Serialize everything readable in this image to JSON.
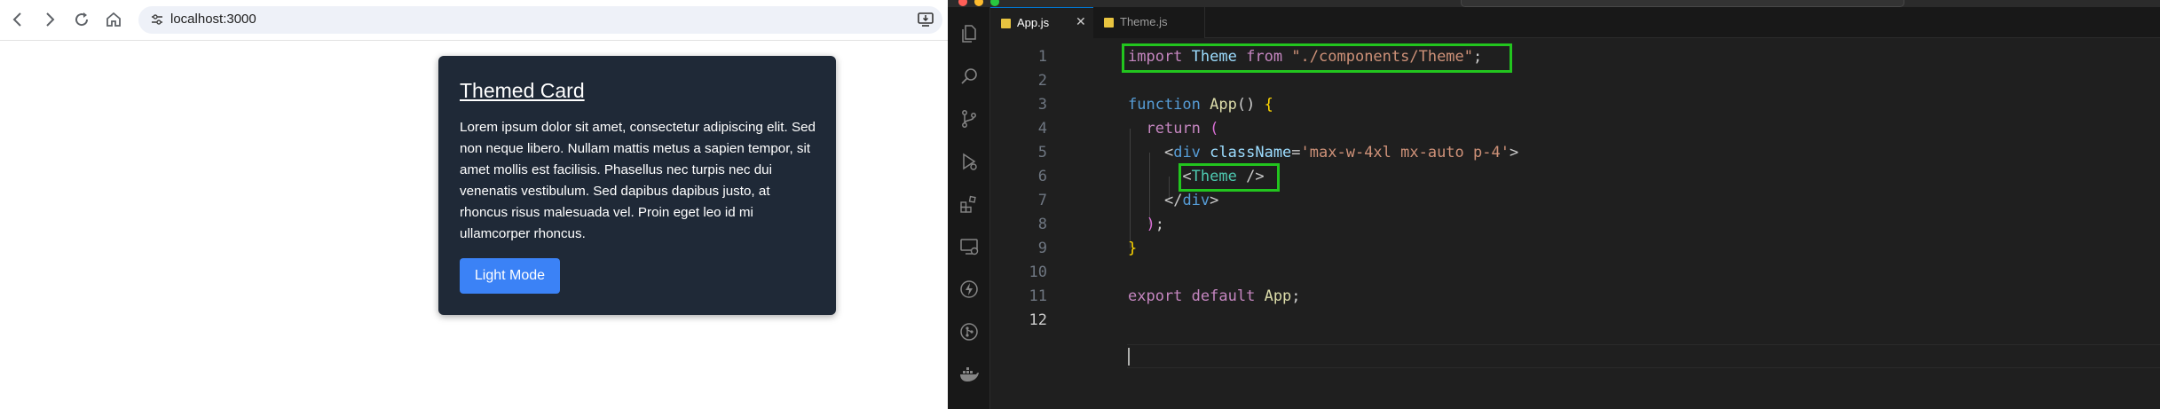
{
  "browser": {
    "url": "localhost:3000",
    "card": {
      "title": "Themed Card",
      "body": "Lorem ipsum dolor sit amet, consectetur adipiscing elit. Sed non neque libero. Nullam mattis metus a sapien tempor, sit amet mollis est facilisis. Phasellus nec turpis nec dui venenatis vestibulum. Sed dapibus dapibus justo, at rhoncus risus malesuada vel. Proin eget leo id mi ullamcorper rhoncus.",
      "button_label": "Light Mode"
    },
    "icons": [
      "back-icon",
      "forward-icon",
      "reload-icon",
      "home-icon",
      "site-info-icon",
      "install-app-icon"
    ]
  },
  "editor": {
    "tabs": [
      {
        "label": "App.js",
        "active": true
      },
      {
        "label": "Theme.js",
        "active": false
      }
    ],
    "active_line": 12,
    "lines": [
      {
        "num": "1",
        "tokens": [
          {
            "t": "import",
            "c": "kw"
          },
          {
            "t": " "
          },
          {
            "t": "Theme",
            "c": "var"
          },
          {
            "t": " "
          },
          {
            "t": "from",
            "c": "kw"
          },
          {
            "t": " "
          },
          {
            "t": "\"./components/Theme\"",
            "c": "str"
          },
          {
            "t": ";",
            "c": "punc"
          }
        ]
      },
      {
        "num": "2",
        "tokens": []
      },
      {
        "num": "3",
        "tokens": [
          {
            "t": "function",
            "c": "kw2"
          },
          {
            "t": " "
          },
          {
            "t": "App",
            "c": "fn"
          },
          {
            "t": "() ",
            "c": "punc"
          },
          {
            "t": "{",
            "c": "brace"
          }
        ]
      },
      {
        "num": "4",
        "tokens": [
          {
            "t": "  "
          },
          {
            "t": "return",
            "c": "kw"
          },
          {
            "t": " "
          },
          {
            "t": "(",
            "c": "brace2"
          }
        ]
      },
      {
        "num": "5",
        "tokens": [
          {
            "t": "    "
          },
          {
            "t": "<",
            "c": "punc"
          },
          {
            "t": "div",
            "c": "tag"
          },
          {
            "t": " "
          },
          {
            "t": "className",
            "c": "var"
          },
          {
            "t": "=",
            "c": "punc"
          },
          {
            "t": "'max-w-4xl mx-auto p-4'",
            "c": "str"
          },
          {
            "t": ">",
            "c": "punc"
          }
        ]
      },
      {
        "num": "6",
        "tokens": [
          {
            "t": "      "
          },
          {
            "t": "<",
            "c": "punc"
          },
          {
            "t": "Theme",
            "c": "ty"
          },
          {
            "t": " "
          },
          {
            "t": "/>",
            "c": "punc"
          }
        ]
      },
      {
        "num": "7",
        "tokens": [
          {
            "t": "    "
          },
          {
            "t": "</",
            "c": "punc"
          },
          {
            "t": "div",
            "c": "tag"
          },
          {
            "t": ">",
            "c": "punc"
          }
        ]
      },
      {
        "num": "8",
        "tokens": [
          {
            "t": "  "
          },
          {
            "t": ")",
            "c": "brace2"
          },
          {
            "t": ";",
            "c": "punc"
          }
        ]
      },
      {
        "num": "9",
        "tokens": [
          {
            "t": "}",
            "c": "brace"
          }
        ]
      },
      {
        "num": "10",
        "tokens": []
      },
      {
        "num": "11",
        "tokens": [
          {
            "t": "export",
            "c": "kw"
          },
          {
            "t": " "
          },
          {
            "t": "default",
            "c": "kw"
          },
          {
            "t": " "
          },
          {
            "t": "App",
            "c": "fn"
          },
          {
            "t": ";",
            "c": "punc"
          }
        ]
      },
      {
        "num": "12",
        "tokens": []
      }
    ],
    "icons": [
      "explorer-icon",
      "search-icon",
      "source-control-icon",
      "run-debug-icon",
      "extensions-icon",
      "remote-explorer-icon",
      "lightning-icon",
      "git-graph-icon",
      "docker-icon"
    ]
  },
  "colors": {
    "card_bg": "#1f2937",
    "button_bg": "#3b82f6",
    "highlight_green": "#22c51e",
    "editor_bg": "#1f1f1f"
  }
}
